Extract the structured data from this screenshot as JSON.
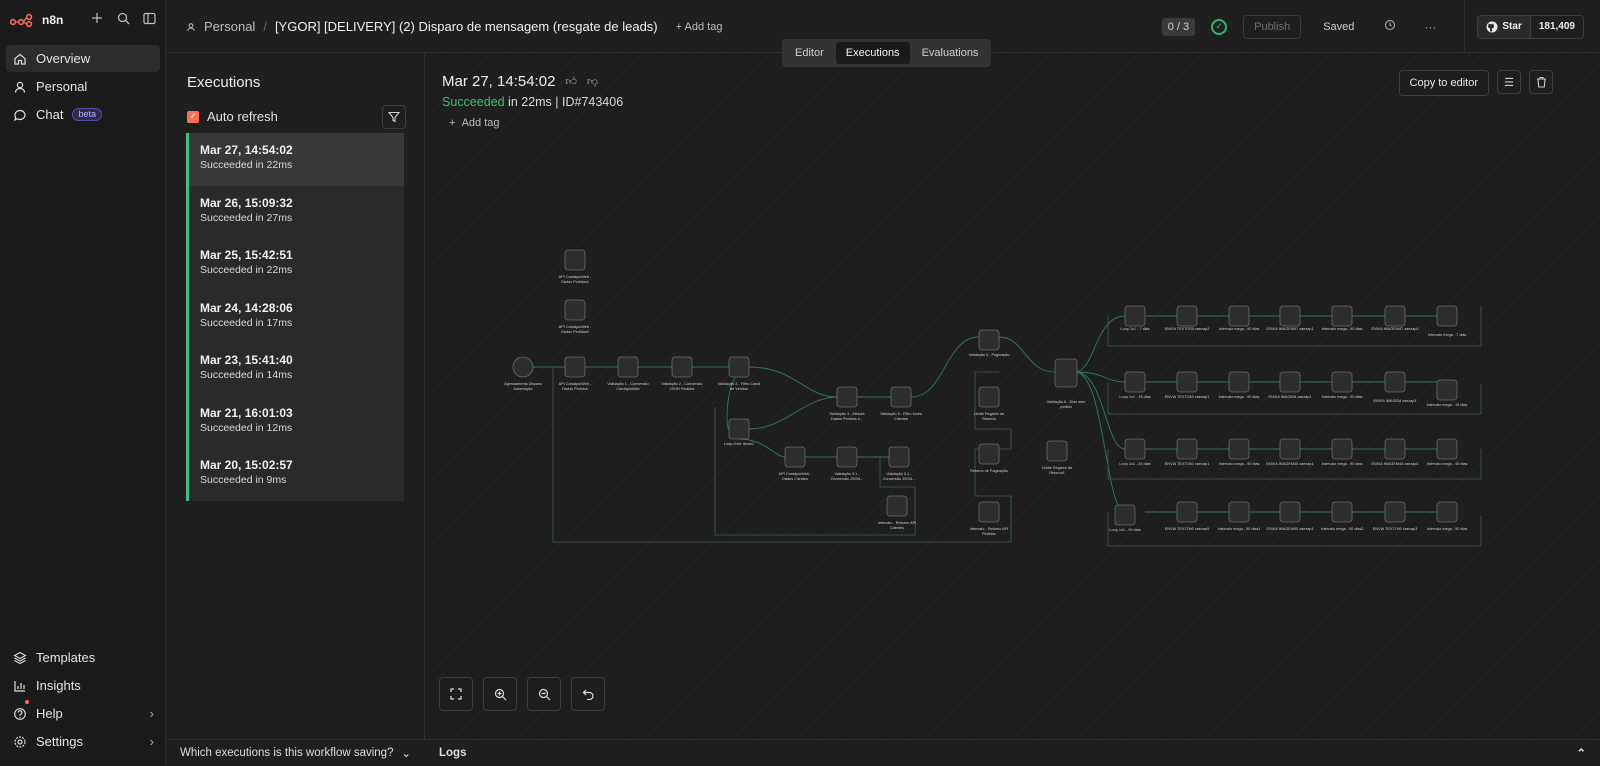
{
  "brand": {
    "name": "n8n"
  },
  "sidebar": {
    "items": [
      {
        "label": "Overview",
        "icon": "home-icon"
      },
      {
        "label": "Personal",
        "icon": "user-icon"
      },
      {
        "label": "Chat",
        "icon": "chat-icon",
        "badge": "beta"
      }
    ],
    "bottom_items": [
      {
        "label": "Templates",
        "icon": "templates-icon"
      },
      {
        "label": "Insights",
        "icon": "chart-icon"
      },
      {
        "label": "Help",
        "icon": "help-icon"
      },
      {
        "label": "Settings",
        "icon": "gear-icon"
      }
    ]
  },
  "header": {
    "project": "Personal",
    "workflow_title": "[YGOR] [DELIVERY] (2) Disparo de mensagem (resgate de leads)",
    "add_tag": "+ Add tag",
    "counter": "0 / 3",
    "publish": "Publish",
    "saved": "Saved",
    "github_star": "Star",
    "github_count": "181,409"
  },
  "tabs": [
    "Editor",
    "Executions",
    "Evaluations"
  ],
  "executions": {
    "title": "Executions",
    "auto_refresh": "Auto refresh",
    "items": [
      {
        "date": "Mar 27, 14:54:02",
        "status": "Succeeded in 22ms"
      },
      {
        "date": "Mar 26, 15:09:32",
        "status": "Succeeded in 27ms"
      },
      {
        "date": "Mar 25, 15:42:51",
        "status": "Succeeded in 22ms"
      },
      {
        "date": "Mar 24, 14:28:06",
        "status": "Succeeded in 17ms"
      },
      {
        "date": "Mar 23, 15:41:40",
        "status": "Succeeded in 14ms"
      },
      {
        "date": "Mar 21, 16:01:03",
        "status": "Succeeded in 12ms"
      },
      {
        "date": "Mar 20, 15:02:57",
        "status": "Succeeded in 9ms"
      }
    ],
    "footer": "Which executions is this workflow saving?"
  },
  "run": {
    "time": "Mar 27, 14:54:02",
    "status": "Succeeded",
    "duration": " in 22ms | ID#743406",
    "add_tag": "Add tag",
    "copy_to_editor": "Copy to editor"
  },
  "logs": {
    "label": "Logs"
  },
  "colors": {
    "accent": "#ff6d5a",
    "success": "#3fbf82"
  }
}
